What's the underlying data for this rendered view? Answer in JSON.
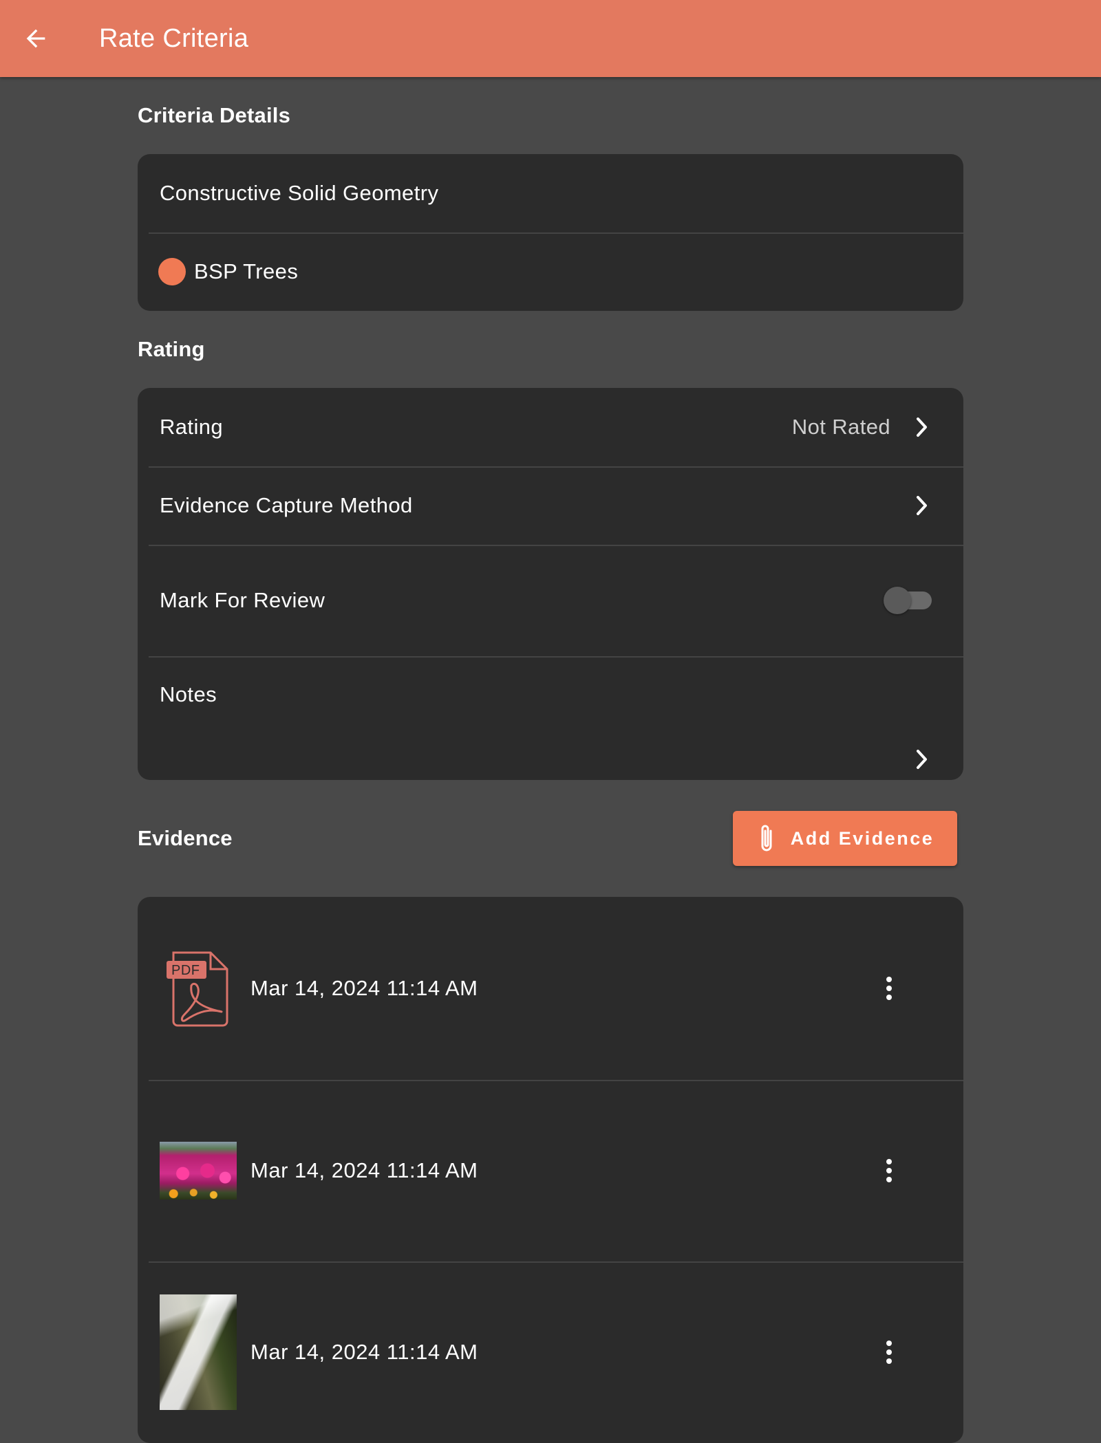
{
  "appbar": {
    "title": "Rate Criteria",
    "back_icon": "arrow-back-icon",
    "background_color": "#e3795f"
  },
  "criteria_details": {
    "heading": "Criteria Details",
    "name": "Constructive Solid Geometry",
    "category": {
      "label": "BSP Trees",
      "color": "#f07a54"
    }
  },
  "rating_section": {
    "heading": "Rating",
    "rating_label": "Rating",
    "rating_value": "Not Rated",
    "capture_method_label": "Evidence Capture Method",
    "mark_for_review_label": "Mark For Review",
    "mark_for_review_on": false,
    "notes_label": "Notes"
  },
  "evidence": {
    "heading": "Evidence",
    "add_button_label": "Add Evidence",
    "accent_color": "#f07a54",
    "items": [
      {
        "type": "pdf",
        "thumbnail_icon": "pdf-file-icon",
        "date": "Mar 14, 2024 11:14 AM"
      },
      {
        "type": "image",
        "thumbnail_icon": "flowers-image",
        "date": "Mar 14, 2024 11:14 AM"
      },
      {
        "type": "image",
        "thumbnail_icon": "waterfall-image",
        "date": "Mar 14, 2024 11:14 AM"
      }
    ]
  }
}
